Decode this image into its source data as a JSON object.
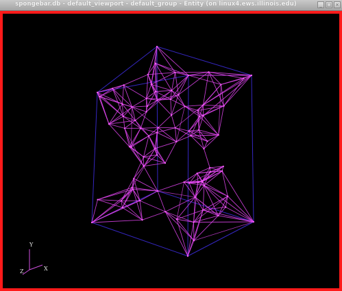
{
  "window": {
    "title": "spongebar.db - default_viewport - default_group - Entity (on linux4.ews.illinois.edu)"
  },
  "axes": {
    "y_label": "Y",
    "x_label": "X",
    "z_label": "Z"
  },
  "colors": {
    "frame_border": "#ff1a1a",
    "background": "#000000",
    "bounding_box": "#3b2bd6",
    "mesh": "#e045f0",
    "node": "#ff66ff",
    "axis": "#d050e0"
  },
  "icons": [
    "minimize-icon",
    "maximize-icon",
    "close-icon"
  ]
}
